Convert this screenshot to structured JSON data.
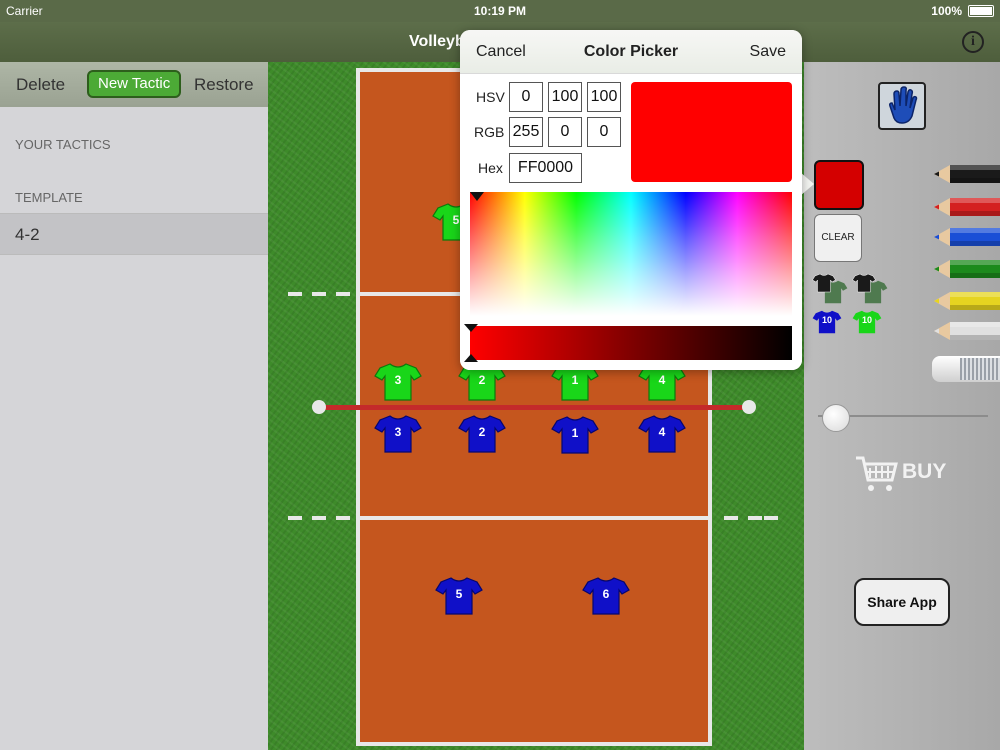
{
  "status_bar": {
    "carrier": "Carrier",
    "time": "10:19 PM",
    "battery": "100%"
  },
  "nav": {
    "title": "Volleyb",
    "info_icon": "info-icon"
  },
  "sidebar": {
    "delete_label": "Delete",
    "new_tactic_label": "New Tactic",
    "restore_label": "Restore",
    "your_tactics_header": "YOUR TACTICS",
    "template_header": "TEMPLATE",
    "templates": [
      "4-2"
    ]
  },
  "court": {
    "green_players": [
      "5",
      "3",
      "2",
      "1",
      "4"
    ],
    "blue_players": [
      "3",
      "2",
      "1",
      "4",
      "5",
      "6"
    ],
    "colors": {
      "green_team": "#19d619",
      "blue_team": "#1010c8",
      "court": "#c5561e",
      "net": "#c42a2a"
    }
  },
  "tools": {
    "selected_color": "#d40000",
    "clear_label": "CLEAR",
    "mini_shirt_number": "10",
    "pencil_colors": [
      "#1a1a1a",
      "#d42020",
      "#1a4fd6",
      "#1c8a1c",
      "#e6d420",
      "#e0e0e0"
    ],
    "buy_label": "BUY",
    "share_label": "Share App"
  },
  "color_picker": {
    "cancel_label": "Cancel",
    "title": "Color Picker",
    "save_label": "Save",
    "hsv_label": "HSV",
    "hsv": [
      "0",
      "100",
      "100"
    ],
    "rgb_label": "RGB",
    "rgb": [
      "255",
      "0",
      "0"
    ],
    "hex_label": "Hex",
    "hex": "FF0000",
    "preview_color": "#ff0000"
  }
}
